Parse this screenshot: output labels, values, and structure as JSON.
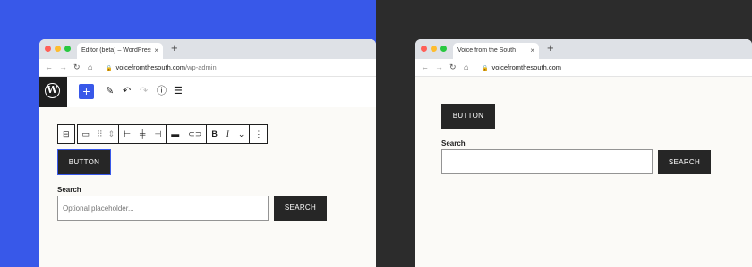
{
  "colors": {
    "left_bg": "#3858e9",
    "right_bg": "#2c2c2c",
    "accent": "#3858e9",
    "button_bg": "#262626"
  },
  "left": {
    "tab_title": "Editor (beta) – WordPress",
    "tab_close": "×",
    "newtab": "+",
    "url_domain": "voicefromthesouth.com",
    "url_path": "/wp-admin",
    "toolbar": {
      "add": "+",
      "logo": "W"
    },
    "block_toolbar": {
      "bold": "B",
      "italic": "I",
      "more": "⋮"
    },
    "button_label": "BUTTON",
    "search_label": "Search",
    "search_placeholder": "Optional placeholder...",
    "search_button": "SEARCH"
  },
  "right": {
    "tab_title": "Voice from the South",
    "tab_close": "×",
    "newtab": "+",
    "url_domain": "voicefromthesouth.com",
    "button_label": "BUTTON",
    "search_label": "Search",
    "search_button": "SEARCH"
  },
  "icons": [
    "back-arrow-icon",
    "forward-arrow-icon",
    "reload-icon",
    "home-icon",
    "lock-icon",
    "pen-icon",
    "undo-icon",
    "redo-icon",
    "info-icon",
    "list-view-icon"
  ]
}
